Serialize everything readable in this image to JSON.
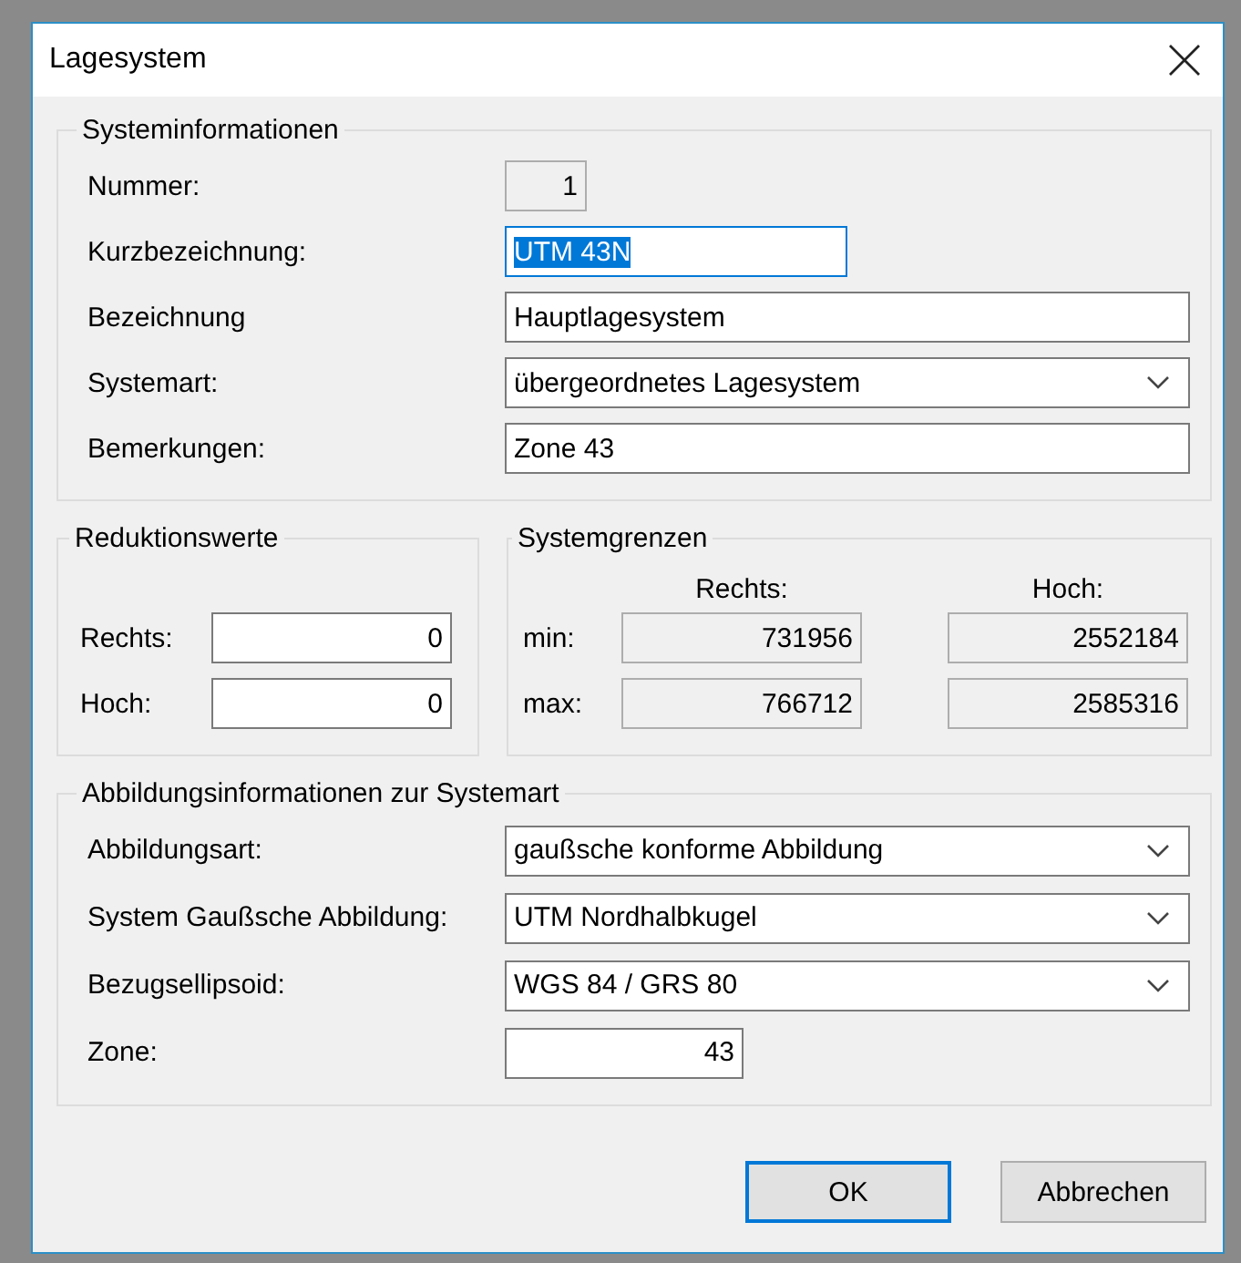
{
  "window": {
    "title": "Lagesystem"
  },
  "system_info": {
    "title": "Systeminformationen",
    "fields": [
      {
        "label": "Nummer:",
        "kind": "readonly",
        "value": "1",
        "focused": false
      },
      {
        "label": "Kurzbezeichnung:",
        "kind": "text",
        "value": "UTM 43N",
        "focused": true
      },
      {
        "label": "Bezeichnung",
        "kind": "text",
        "value": "Hauptlagesystem",
        "focused": false
      },
      {
        "label": "Systemart:",
        "kind": "dropdown",
        "value": "übergeordnetes Lagesystem",
        "focused": false
      },
      {
        "label": "Bemerkungen:",
        "kind": "text",
        "value": "Zone 43",
        "focused": false
      }
    ]
  },
  "reduction": {
    "title": "Reduktionswerte",
    "fields": [
      {
        "label": "Rechts:",
        "value": "0"
      },
      {
        "label": "Hoch:",
        "value": "0"
      }
    ]
  },
  "limits": {
    "title": "Systemgrenzen",
    "columns": [
      "Rechts:",
      "Hoch:"
    ],
    "rows": [
      {
        "label": "min:",
        "values": [
          "731956",
          "2552184"
        ]
      },
      {
        "label": "max:",
        "values": [
          "766712",
          "2585316"
        ]
      }
    ]
  },
  "projection": {
    "title": "Abbildungsinformationen zur Systemart",
    "fields": [
      {
        "label": "Abbildungsart:",
        "kind": "dropdown",
        "value": "gaußsche konforme Abbildung",
        "focused": false
      },
      {
        "label": "System Gaußsche Abbildung:",
        "kind": "dropdown",
        "value": "UTM Nordhalbkugel",
        "focused": false
      },
      {
        "label": "Bezugsellipsoid:",
        "kind": "dropdown",
        "value": "WGS 84 / GRS 80",
        "focused": false
      },
      {
        "label": "Zone:",
        "kind": "number",
        "value": "43",
        "focused": false
      }
    ]
  },
  "buttons": [
    {
      "label": "OK",
      "default": true
    },
    {
      "label": "Abbrechen",
      "default": false
    }
  ]
}
